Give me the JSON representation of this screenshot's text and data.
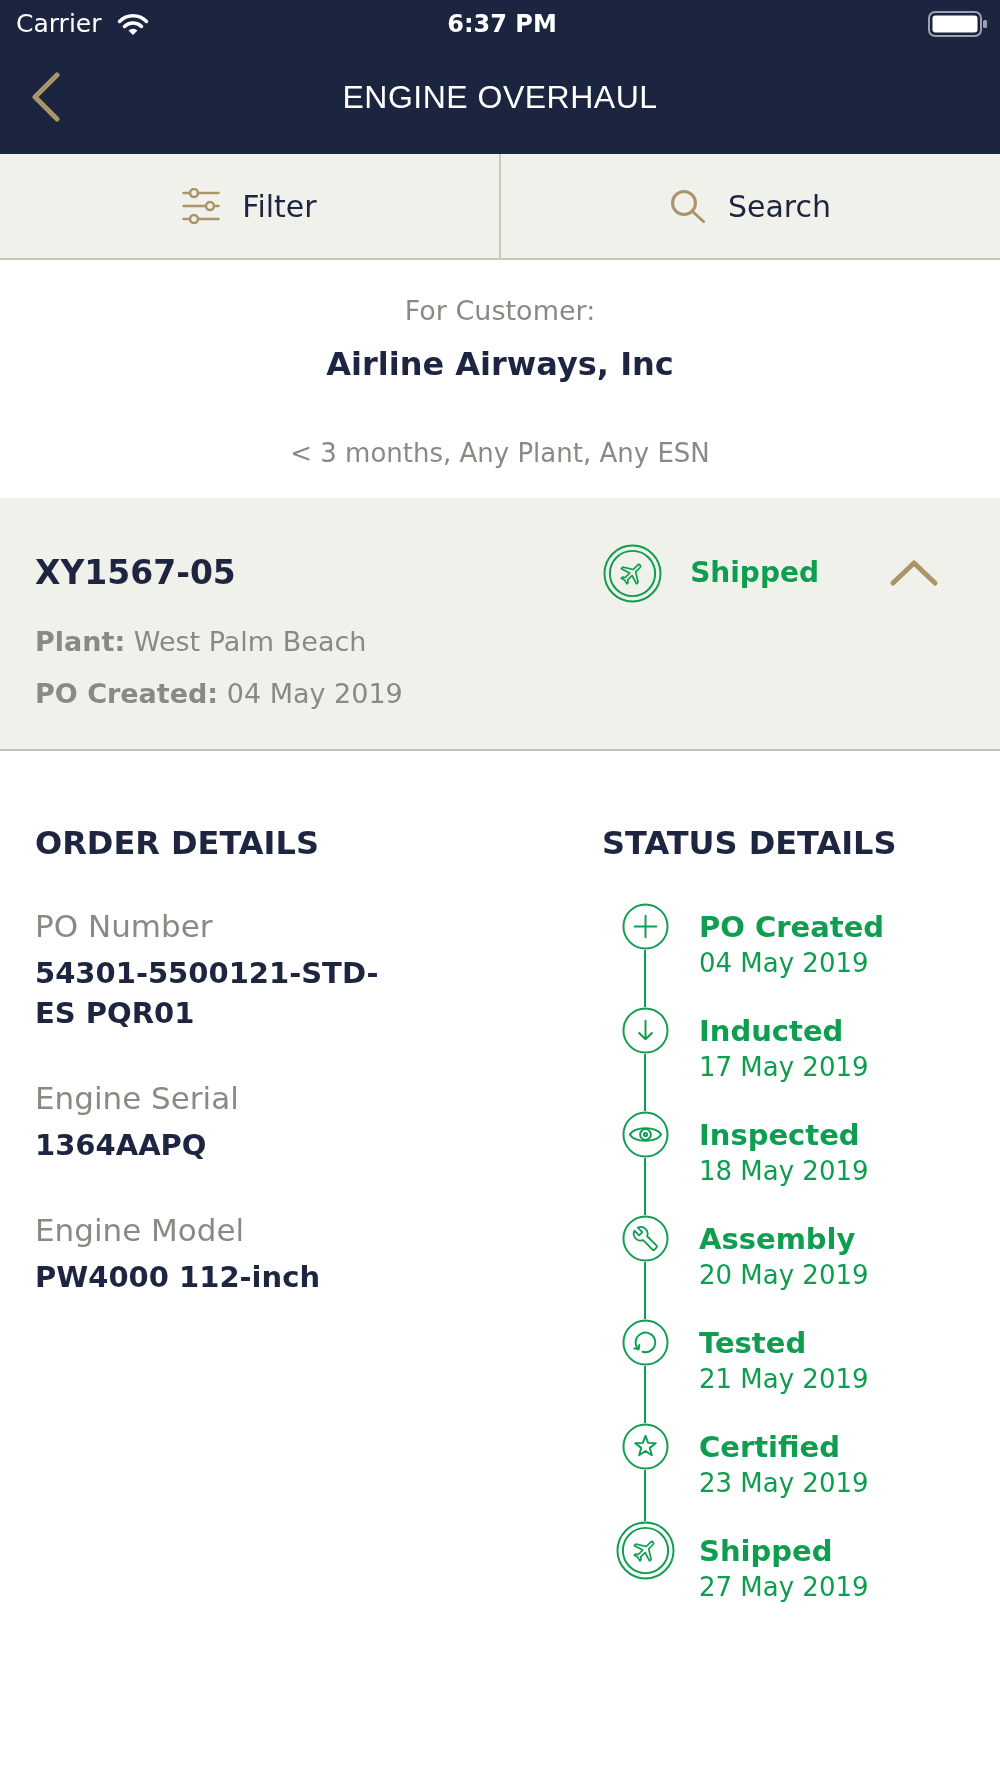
{
  "status_bar": {
    "carrier": "Carrier",
    "time": "6:37 PM"
  },
  "nav_bar": {
    "title": "ENGINE OVERHAUL"
  },
  "toolbar": [
    {
      "kind": "filter",
      "label": "Filter"
    },
    {
      "kind": "search",
      "label": "Search"
    }
  ],
  "customer": {
    "caption": "For Customer:",
    "name": "Airline Airways, Inc",
    "filter_summary": "< 3 months, Any Plant, Any ESN"
  },
  "order": {
    "id": "XY1567-05",
    "status": {
      "kind": "shipped",
      "label": "Shipped"
    },
    "expanded": true,
    "info": [
      "**Plant:** West Palm Beach",
      "**PO Created:** 04 May 2019"
    ]
  },
  "order_details": {
    "heading": "ORDER DETAILS",
    "fields": [
      {
        "label": "PO Number",
        "value": "54301-5500121-STD-ES PQR01"
      },
      {
        "label": "Engine Serial",
        "value": "1364AAPQ"
      },
      {
        "label": "Engine Model",
        "value": "PW4000 112-inch"
      }
    ]
  },
  "status_details": {
    "heading": "STATUS DETAILS",
    "steps": [
      {
        "kind": "created",
        "title": "PO Created",
        "date": "04 May 2019"
      },
      {
        "kind": "inducted",
        "title": "Inducted",
        "date": "17 May 2019"
      },
      {
        "kind": "inspected",
        "title": "Inspected",
        "date": "18 May 2019"
      },
      {
        "kind": "assembly",
        "title": "Assembly",
        "date": "20 May 2019"
      },
      {
        "kind": "tested",
        "title": "Tested",
        "date": "21 May 2019"
      },
      {
        "kind": "certified",
        "title": "Certified",
        "date": "23 May 2019"
      },
      {
        "kind": "shipped",
        "title": "Shipped",
        "date": "27 May 2019"
      }
    ]
  }
}
